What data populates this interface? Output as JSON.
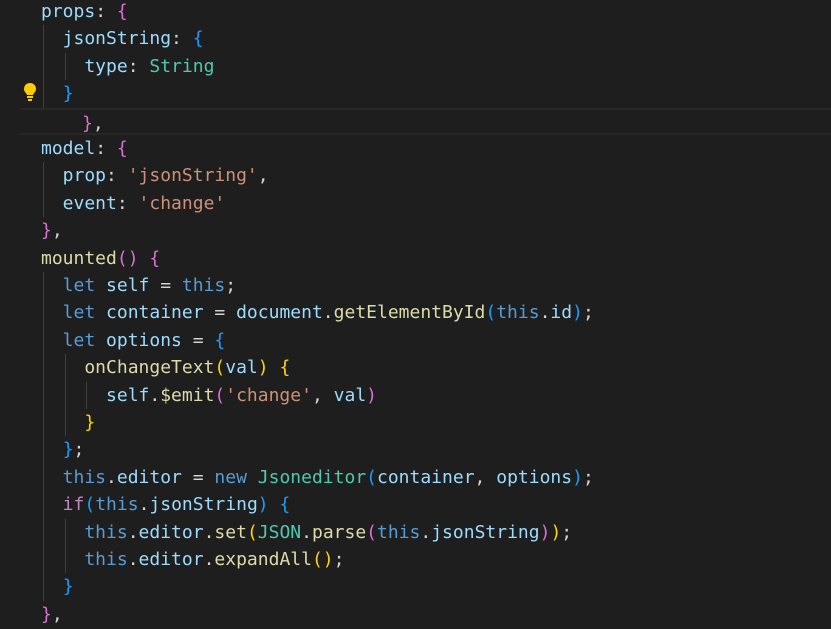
{
  "colors": {
    "background": "#1e1e1e",
    "keyword": "#569cd6",
    "variable": "#9cdcfe",
    "function": "#dcdcaa",
    "string": "#ce9178",
    "type": "#4ec9b0",
    "control": "#c586c0",
    "punctuation": "#d4d4d4",
    "bracket_gold": "#ffd700",
    "bracket_purple": "#da70d6",
    "bracket_blue": "#179fff",
    "lightbulb": "#ffcc00"
  },
  "gutter": {
    "lightbulb_icon": "lightbulb-icon"
  },
  "lines": [
    {
      "tokens": [
        {
          "t": "props",
          "c": "variable"
        },
        {
          "t": ": ",
          "c": "punctuation"
        },
        {
          "t": "{",
          "c": "bracket_purple"
        }
      ]
    },
    {
      "tokens": [
        {
          "t": "  jsonString",
          "c": "variable"
        },
        {
          "t": ": ",
          "c": "punctuation"
        },
        {
          "t": "{",
          "c": "bracket_blue"
        }
      ]
    },
    {
      "tokens": [
        {
          "t": "    type",
          "c": "variable"
        },
        {
          "t": ": ",
          "c": "punctuation"
        },
        {
          "t": "String",
          "c": "type"
        }
      ]
    },
    {
      "tokens": [
        {
          "t": "  ",
          "c": "punctuation"
        },
        {
          "t": "}",
          "c": "bracket_blue"
        }
      ]
    },
    {
      "current": true,
      "tokens": [
        {
          "t": "}",
          "c": "bracket_purple"
        },
        {
          "t": ",",
          "c": "punctuation"
        }
      ]
    },
    {
      "tokens": [
        {
          "t": "model",
          "c": "variable"
        },
        {
          "t": ": ",
          "c": "punctuation"
        },
        {
          "t": "{",
          "c": "bracket_purple"
        }
      ]
    },
    {
      "tokens": [
        {
          "t": "  prop",
          "c": "variable"
        },
        {
          "t": ": ",
          "c": "punctuation"
        },
        {
          "t": "'jsonString'",
          "c": "string"
        },
        {
          "t": ",",
          "c": "punctuation"
        }
      ]
    },
    {
      "tokens": [
        {
          "t": "  event",
          "c": "variable"
        },
        {
          "t": ": ",
          "c": "punctuation"
        },
        {
          "t": "'change'",
          "c": "string"
        }
      ]
    },
    {
      "tokens": [
        {
          "t": "}",
          "c": "bracket_purple"
        },
        {
          "t": ",",
          "c": "punctuation"
        }
      ]
    },
    {
      "tokens": [
        {
          "t": "mounted",
          "c": "function"
        },
        {
          "t": "()",
          "c": "bracket_purple"
        },
        {
          "t": " ",
          "c": "punctuation"
        },
        {
          "t": "{",
          "c": "bracket_purple"
        }
      ]
    },
    {
      "tokens": [
        {
          "t": "  let",
          "c": "keyword"
        },
        {
          "t": " ",
          "c": "punctuation"
        },
        {
          "t": "self",
          "c": "variable"
        },
        {
          "t": " = ",
          "c": "punctuation"
        },
        {
          "t": "this",
          "c": "keyword"
        },
        {
          "t": ";",
          "c": "punctuation"
        }
      ]
    },
    {
      "tokens": [
        {
          "t": "  let",
          "c": "keyword"
        },
        {
          "t": " ",
          "c": "punctuation"
        },
        {
          "t": "container",
          "c": "variable"
        },
        {
          "t": " = ",
          "c": "punctuation"
        },
        {
          "t": "document",
          "c": "variable"
        },
        {
          "t": ".",
          "c": "punctuation"
        },
        {
          "t": "getElementById",
          "c": "function"
        },
        {
          "t": "(",
          "c": "bracket_blue"
        },
        {
          "t": "this",
          "c": "keyword"
        },
        {
          "t": ".",
          "c": "punctuation"
        },
        {
          "t": "id",
          "c": "variable"
        },
        {
          "t": ")",
          "c": "bracket_blue"
        },
        {
          "t": ";",
          "c": "punctuation"
        }
      ]
    },
    {
      "tokens": [
        {
          "t": "  let",
          "c": "keyword"
        },
        {
          "t": " ",
          "c": "punctuation"
        },
        {
          "t": "options",
          "c": "variable"
        },
        {
          "t": " = ",
          "c": "punctuation"
        },
        {
          "t": "{",
          "c": "bracket_blue"
        }
      ]
    },
    {
      "tokens": [
        {
          "t": "    onChangeText",
          "c": "function"
        },
        {
          "t": "(",
          "c": "bracket_gold"
        },
        {
          "t": "val",
          "c": "variable"
        },
        {
          "t": ")",
          "c": "bracket_gold"
        },
        {
          "t": " ",
          "c": "punctuation"
        },
        {
          "t": "{",
          "c": "bracket_gold"
        }
      ]
    },
    {
      "tokens": [
        {
          "t": "      self",
          "c": "variable"
        },
        {
          "t": ".",
          "c": "punctuation"
        },
        {
          "t": "$emit",
          "c": "function"
        },
        {
          "t": "(",
          "c": "bracket_purple"
        },
        {
          "t": "'change'",
          "c": "string"
        },
        {
          "t": ", ",
          "c": "punctuation"
        },
        {
          "t": "val",
          "c": "variable"
        },
        {
          "t": ")",
          "c": "bracket_purple"
        }
      ]
    },
    {
      "tokens": [
        {
          "t": "    ",
          "c": "punctuation"
        },
        {
          "t": "}",
          "c": "bracket_gold"
        }
      ]
    },
    {
      "tokens": [
        {
          "t": "  ",
          "c": "punctuation"
        },
        {
          "t": "}",
          "c": "bracket_blue"
        },
        {
          "t": ";",
          "c": "punctuation"
        }
      ]
    },
    {
      "tokens": [
        {
          "t": "  this",
          "c": "keyword"
        },
        {
          "t": ".",
          "c": "punctuation"
        },
        {
          "t": "editor",
          "c": "variable"
        },
        {
          "t": " = ",
          "c": "punctuation"
        },
        {
          "t": "new",
          "c": "keyword"
        },
        {
          "t": " ",
          "c": "punctuation"
        },
        {
          "t": "Jsoneditor",
          "c": "type"
        },
        {
          "t": "(",
          "c": "bracket_blue"
        },
        {
          "t": "container",
          "c": "variable"
        },
        {
          "t": ", ",
          "c": "punctuation"
        },
        {
          "t": "options",
          "c": "variable"
        },
        {
          "t": ")",
          "c": "bracket_blue"
        },
        {
          "t": ";",
          "c": "punctuation"
        }
      ]
    },
    {
      "tokens": [
        {
          "t": "  if",
          "c": "control"
        },
        {
          "t": "(",
          "c": "bracket_blue"
        },
        {
          "t": "this",
          "c": "keyword"
        },
        {
          "t": ".",
          "c": "punctuation"
        },
        {
          "t": "jsonString",
          "c": "variable"
        },
        {
          "t": ")",
          "c": "bracket_blue"
        },
        {
          "t": " ",
          "c": "punctuation"
        },
        {
          "t": "{",
          "c": "bracket_blue"
        }
      ]
    },
    {
      "tokens": [
        {
          "t": "    this",
          "c": "keyword"
        },
        {
          "t": ".",
          "c": "punctuation"
        },
        {
          "t": "editor",
          "c": "variable"
        },
        {
          "t": ".",
          "c": "punctuation"
        },
        {
          "t": "set",
          "c": "function"
        },
        {
          "t": "(",
          "c": "bracket_gold"
        },
        {
          "t": "JSON",
          "c": "type"
        },
        {
          "t": ".",
          "c": "punctuation"
        },
        {
          "t": "parse",
          "c": "function"
        },
        {
          "t": "(",
          "c": "bracket_purple"
        },
        {
          "t": "this",
          "c": "keyword"
        },
        {
          "t": ".",
          "c": "punctuation"
        },
        {
          "t": "jsonString",
          "c": "variable"
        },
        {
          "t": ")",
          "c": "bracket_purple"
        },
        {
          "t": ")",
          "c": "bracket_gold"
        },
        {
          "t": ";",
          "c": "punctuation"
        }
      ]
    },
    {
      "tokens": [
        {
          "t": "    this",
          "c": "keyword"
        },
        {
          "t": ".",
          "c": "punctuation"
        },
        {
          "t": "editor",
          "c": "variable"
        },
        {
          "t": ".",
          "c": "punctuation"
        },
        {
          "t": "expandAll",
          "c": "function"
        },
        {
          "t": "()",
          "c": "bracket_gold"
        },
        {
          "t": ";",
          "c": "punctuation"
        }
      ]
    },
    {
      "tokens": [
        {
          "t": "  ",
          "c": "punctuation"
        },
        {
          "t": "}",
          "c": "bracket_blue"
        }
      ]
    },
    {
      "tokens": [
        {
          "t": "}",
          "c": "bracket_purple"
        },
        {
          "t": ",",
          "c": "punctuation"
        }
      ]
    }
  ]
}
